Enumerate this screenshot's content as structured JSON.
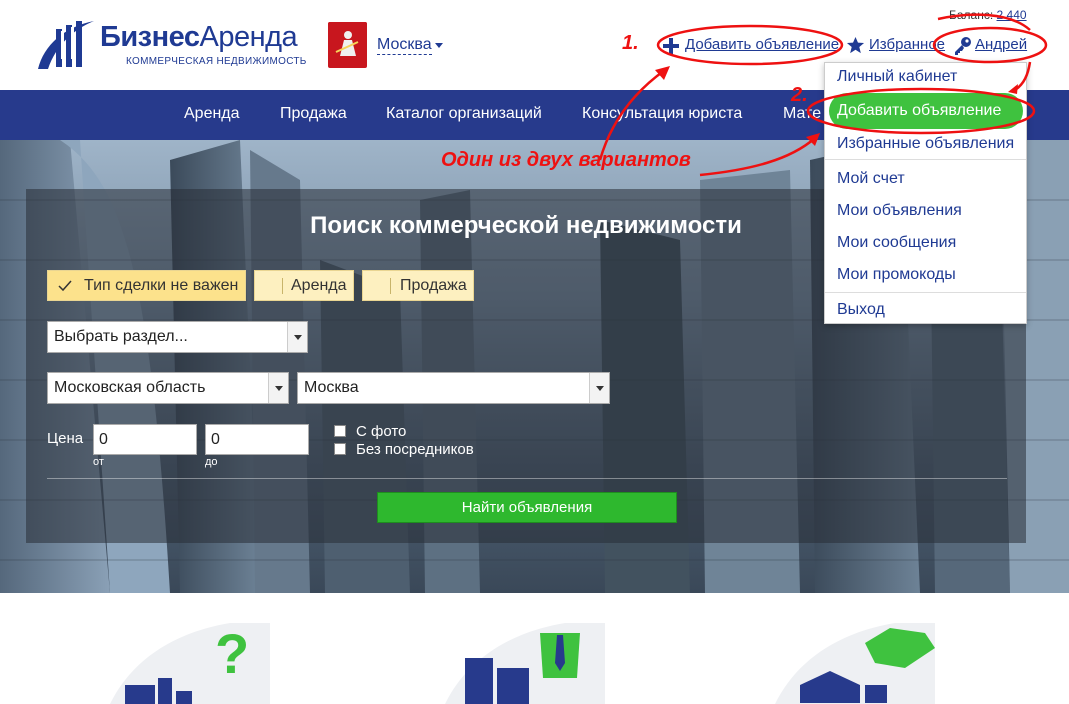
{
  "header": {
    "logo_bold": "Бизнес",
    "logo_rest": "Аренда",
    "logo_sub": "КОММЕРЧЕСКАЯ НЕДВИЖИМОСТЬ",
    "city": "Москва",
    "balance_label": "Баланс:",
    "balance_value": "2 440",
    "add_listing": "Добавить объявление",
    "favorites": "Избранное",
    "user": "Андрей"
  },
  "nav": {
    "items": [
      "Аренда",
      "Продажа",
      "Каталог организаций",
      "Консультация юриста",
      "Мате"
    ]
  },
  "search": {
    "title": "Поиск коммерческой недвижимости",
    "deal_any": "Тип сделки не важен",
    "deal_rent": "Аренда",
    "deal_sale": "Продажа",
    "section_select": "Выбрать раздел...",
    "region_select": "Московская область",
    "city_select": "Москва",
    "price_label": "Цена",
    "price_from": "0",
    "price_to": "0",
    "from_label": "от",
    "to_label": "до",
    "with_photo": "С фото",
    "no_agents": "Без посредников",
    "find_button": "Найти объявления"
  },
  "user_menu": {
    "items": [
      "Личный кабинет",
      "Добавить объявление",
      "Избранные объявления",
      "Мой счет",
      "Мои объявления",
      "Мои сообщения",
      "Мои промокоды",
      "Выход"
    ]
  },
  "annotations": {
    "num1": "1.",
    "num2": "2.",
    "text": "Один из двух вариантов"
  },
  "colors": {
    "brand_blue": "#273a8c",
    "link_blue": "#1f3a93",
    "green": "#3fc23f",
    "annotation_red": "#e11111"
  }
}
